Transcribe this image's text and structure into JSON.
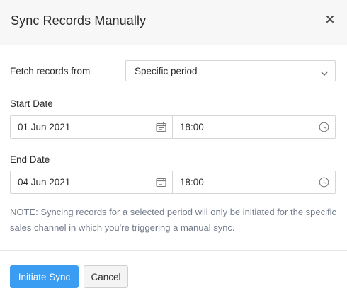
{
  "dialog": {
    "title": "Sync Records Manually",
    "close_icon": "close-icon"
  },
  "fetch": {
    "label": "Fetch records from",
    "selected": "Specific period",
    "chevron_icon": "chevron-down-icon"
  },
  "start": {
    "label": "Start Date",
    "date": "01 Jun 2021",
    "time": "18:00",
    "date_icon": "calendar-icon",
    "time_icon": "clock-icon"
  },
  "end": {
    "label": "End Date",
    "date": "04 Jun 2021",
    "time": "18:00",
    "date_icon": "calendar-icon",
    "time_icon": "clock-icon"
  },
  "note": {
    "prefix": "NOTE:",
    "text": " Syncing records for a selected period will only be initiated for the specific sales channel in which you're triggering a manual sync."
  },
  "footer": {
    "primary_label": "Initiate Sync",
    "cancel_label": "Cancel"
  },
  "colors": {
    "primary": "#3a9df2",
    "header_bg": "#f7f7f7",
    "note_text": "#737b8c"
  }
}
